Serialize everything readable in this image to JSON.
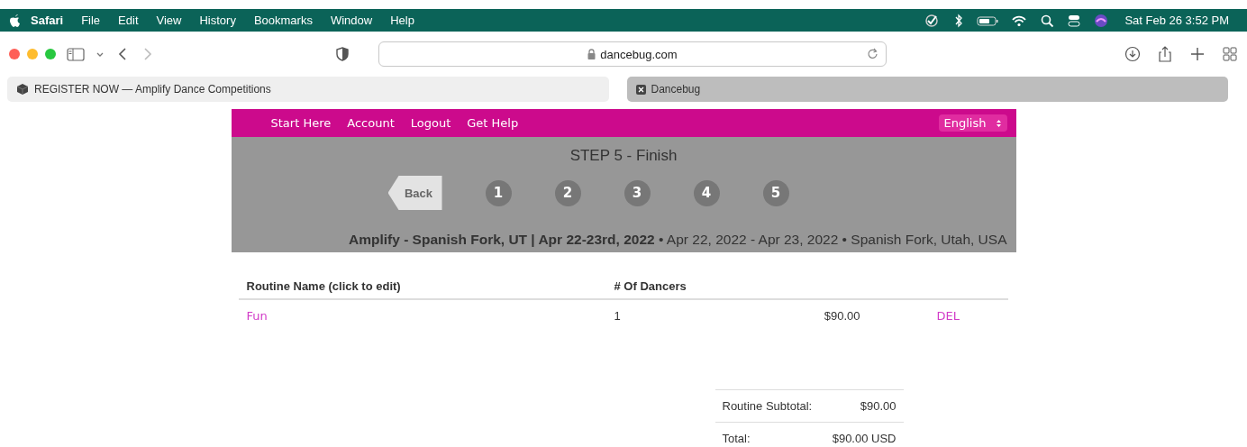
{
  "menu_bar": {
    "app_name": "Safari",
    "items": [
      "File",
      "Edit",
      "View",
      "History",
      "Bookmarks",
      "Window",
      "Help"
    ],
    "date_time": "Sat Feb 26  3:52 PM"
  },
  "browser": {
    "url": "dancebug.com",
    "tabs": [
      {
        "title": "REGISTER NOW — Amplify Dance Competitions",
        "selected": false
      },
      {
        "title": "Dancebug",
        "selected": true
      }
    ]
  },
  "site": {
    "nav": [
      "Start Here",
      "Account",
      "Logout",
      "Get Help"
    ],
    "language": "English",
    "step_title": "STEP 5 - Finish",
    "back": "Back",
    "steps": [
      "1",
      "2",
      "3",
      "4",
      "5"
    ],
    "event": "**Amplify - Spanish Fork, UT | Apr 22-23rd, 2022** • Apr 22, 2022 - Apr 23, 2022 • Spanish Fork, Utah, USA"
  },
  "table": {
    "columns": [
      "Routine Name (click to edit)",
      "# Of Dancers"
    ],
    "rows": [
      {
        "name": "Fun",
        "dancers": "1",
        "price": "$90.00",
        "action": "DEL"
      }
    ]
  },
  "summary": [
    {
      "label": "Routine Subtotal:",
      "value": "$90.00"
    },
    {
      "label": "Total:",
      "value": "$90.00 USD"
    }
  ]
}
